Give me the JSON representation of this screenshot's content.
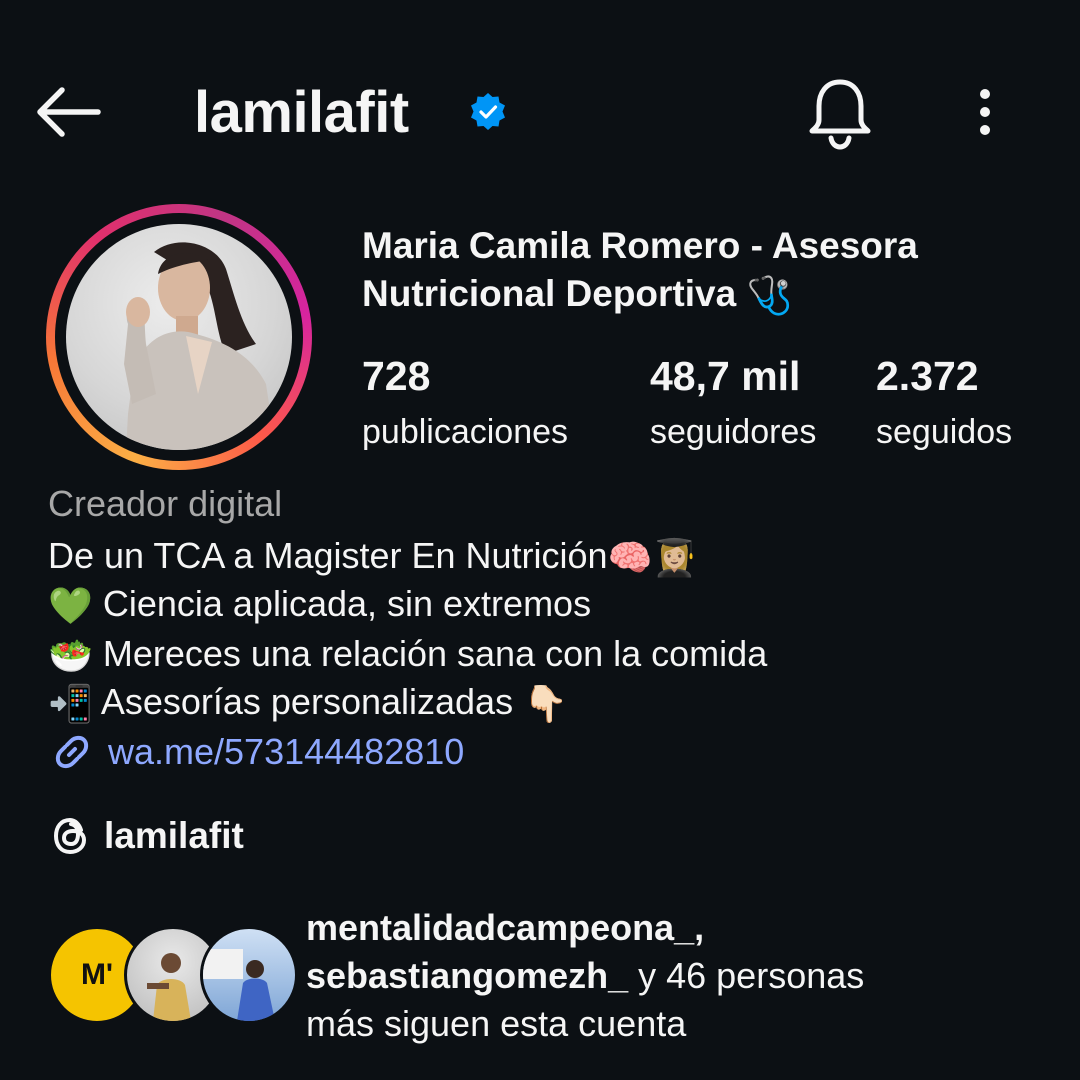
{
  "header": {
    "username": "lamilafit",
    "back_icon": "arrow-left-icon",
    "verified_icon": "verified-badge-icon",
    "bell_icon": "bell-icon",
    "more_icon": "more-vertical-icon"
  },
  "profile": {
    "full_name_line1": "Maria Camila Romero - Asesora",
    "full_name_line2": "Nutricional Deportiva",
    "full_name_emoji": "🩺",
    "stats": [
      {
        "value": "728",
        "label": "publicaciones"
      },
      {
        "value": "48,7 mil",
        "label": "seguidores"
      },
      {
        "value": "2.372",
        "label": "seguidos"
      }
    ]
  },
  "bio": {
    "category": "Creador digital",
    "line1_text": "De un TCA a Magister En Nutrición",
    "line1_emoji": "🧠👩🏼‍🎓",
    "line2_emoji": "💚",
    "line2_text": "Ciencia aplicada, sin extremos",
    "line3_emoji": "🥗",
    "line3_text": "Mereces una relación sana con la comida",
    "line4_emoji": "📲",
    "line4_text": "Asesorías personalizadas",
    "line4_end_emoji": "👇🏻",
    "link": "wa.me/573144482810",
    "threads_handle": "lamilafit"
  },
  "followed_by": {
    "user1": "mentalidadcampeona_,",
    "user2": "sebastiangomezh_",
    "suffix_line2": " y 46 personas",
    "line3": "más siguen esta cuenta",
    "avatar1_initial": "M'"
  },
  "colors": {
    "background": "#0c1014",
    "link": "#8ea8ff",
    "verified": "#0095f6",
    "muted": "#a8a8a8"
  }
}
